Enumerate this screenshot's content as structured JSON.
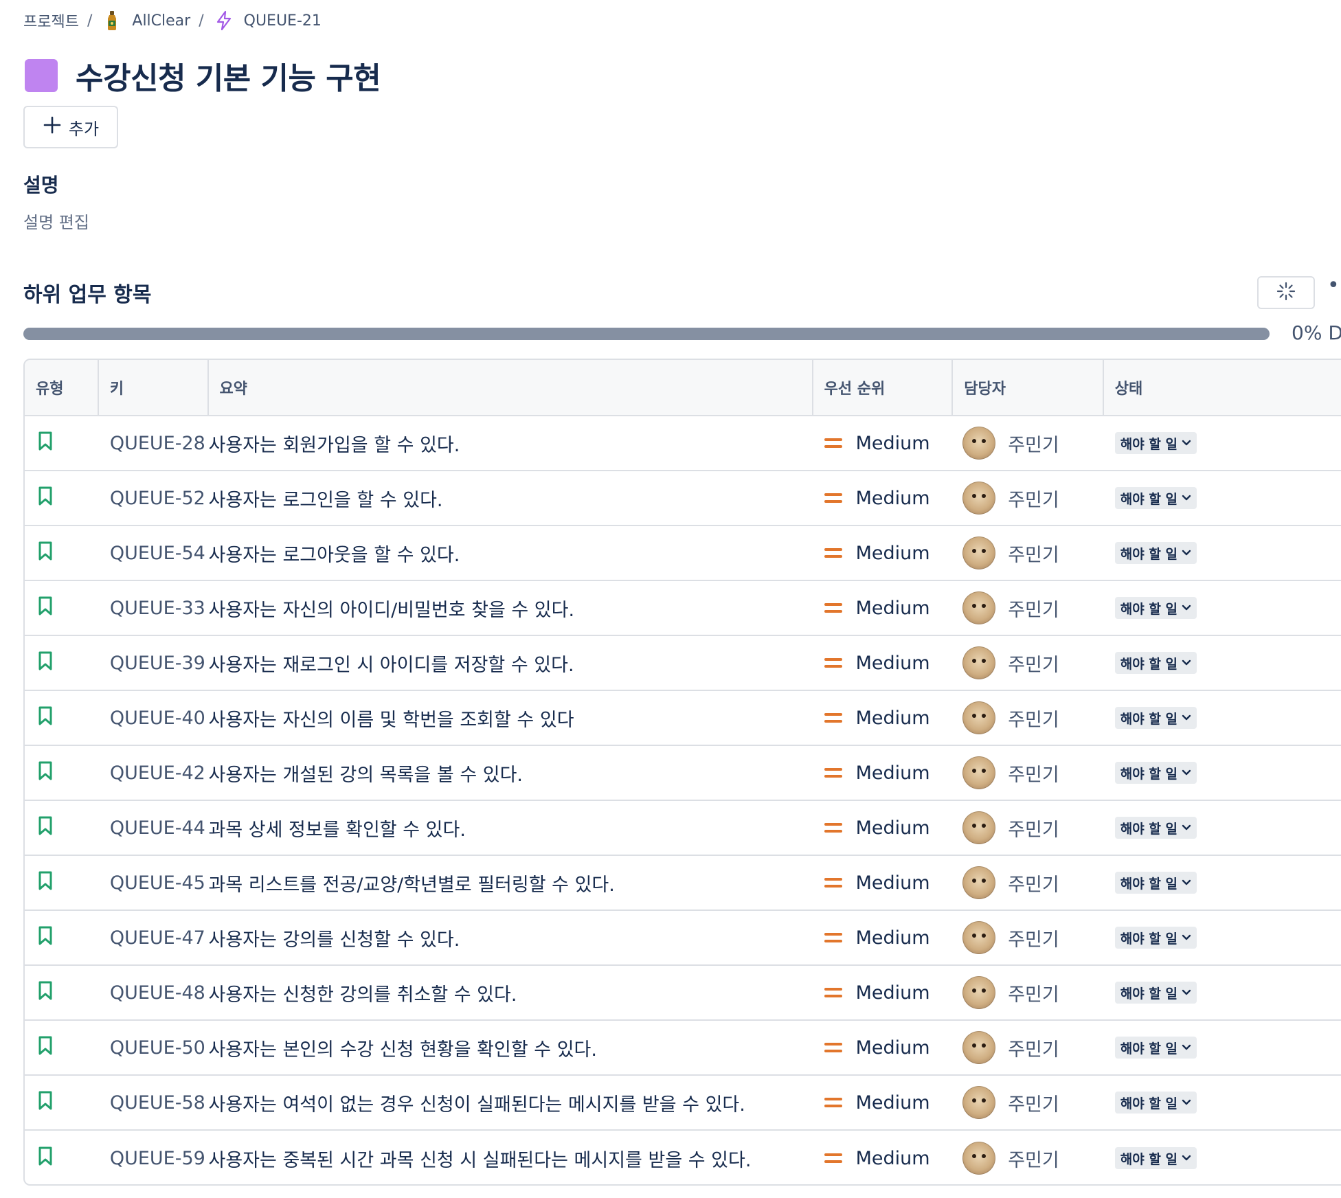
{
  "breadcrumb": {
    "projects": "프로젝트",
    "project_name": "AllClear",
    "issue_key": "QUEUE-21",
    "separator": "/"
  },
  "epic": {
    "title": "수강신청 기본 기능 구현",
    "color": "#bf84f0"
  },
  "actions": {
    "add_label": "추가"
  },
  "description": {
    "heading": "설명",
    "edit_placeholder": "설명 편집"
  },
  "subtasks": {
    "heading": "하위 업무 항목",
    "progress_percent": 0,
    "progress_label": "0% D",
    "columns": {
      "type": "유형",
      "key": "키",
      "summary": "요약",
      "priority": "우선 순위",
      "assignee": "담당자",
      "status": "상태"
    },
    "items": [
      {
        "key": "QUEUE-28",
        "summary": "사용자는 회원가입을 할 수 있다.",
        "priority": "Medium",
        "assignee": "주민기",
        "status": "해야 할 일"
      },
      {
        "key": "QUEUE-52",
        "summary": "사용자는 로그인을 할 수 있다.",
        "priority": "Medium",
        "assignee": "주민기",
        "status": "해야 할 일"
      },
      {
        "key": "QUEUE-54",
        "summary": "사용자는 로그아웃을 할 수 있다.",
        "priority": "Medium",
        "assignee": "주민기",
        "status": "해야 할 일"
      },
      {
        "key": "QUEUE-33",
        "summary": "사용자는 자신의 아이디/비밀번호 찾을 수 있다.",
        "priority": "Medium",
        "assignee": "주민기",
        "status": "해야 할 일"
      },
      {
        "key": "QUEUE-39",
        "summary": "사용자는 재로그인 시 아이디를 저장할 수 있다.",
        "priority": "Medium",
        "assignee": "주민기",
        "status": "해야 할 일"
      },
      {
        "key": "QUEUE-40",
        "summary": "사용자는 자신의 이름 및 학번을 조회할 수 있다",
        "priority": "Medium",
        "assignee": "주민기",
        "status": "해야 할 일"
      },
      {
        "key": "QUEUE-42",
        "summary": "사용자는 개설된 강의 목록을 볼 수 있다.",
        "priority": "Medium",
        "assignee": "주민기",
        "status": "해야 할 일"
      },
      {
        "key": "QUEUE-44",
        "summary": "과목 상세 정보를 확인할 수 있다.",
        "priority": "Medium",
        "assignee": "주민기",
        "status": "해야 할 일"
      },
      {
        "key": "QUEUE-45",
        "summary": "과목 리스트를 전공/교양/학년별로 필터링할 수 있다.",
        "priority": "Medium",
        "assignee": "주민기",
        "status": "해야 할 일"
      },
      {
        "key": "QUEUE-47",
        "summary": "사용자는 강의를 신청할 수 있다.",
        "priority": "Medium",
        "assignee": "주민기",
        "status": "해야 할 일"
      },
      {
        "key": "QUEUE-48",
        "summary": "사용자는 신청한 강의를 취소할 수 있다.",
        "priority": "Medium",
        "assignee": "주민기",
        "status": "해야 할 일"
      },
      {
        "key": "QUEUE-50",
        "summary": "사용자는 본인의 수강 신청 현황을 확인할 수 있다.",
        "priority": "Medium",
        "assignee": "주민기",
        "status": "해야 할 일"
      },
      {
        "key": "QUEUE-58",
        "summary": "사용자는 여석이 없는 경우 신청이 실패된다는 메시지를 받을 수 있다.",
        "priority": "Medium",
        "assignee": "주민기",
        "status": "해야 할 일"
      },
      {
        "key": "QUEUE-59",
        "summary": "사용자는 중복된 시간 과목 신청 시 실패된다는 메시지를 받을 수 있다.",
        "priority": "Medium",
        "assignee": "주민기",
        "status": "해야 할 일"
      }
    ]
  },
  "icons": {
    "project": "bottle-avatar-icon",
    "epic_key": "lightning-icon",
    "add": "plus-icon",
    "subtask_type": "bookmark-icon",
    "priority": "priority-medium-icon",
    "status_chevron": "chevron-down-icon",
    "sub_options": "sparkle-icon",
    "more": "more-icon"
  },
  "colors": {
    "story_green": "#22a06b",
    "priority_orange": "#e2762c",
    "epic_purple": "#bf84f0",
    "lightning_purple": "#a259e6"
  }
}
